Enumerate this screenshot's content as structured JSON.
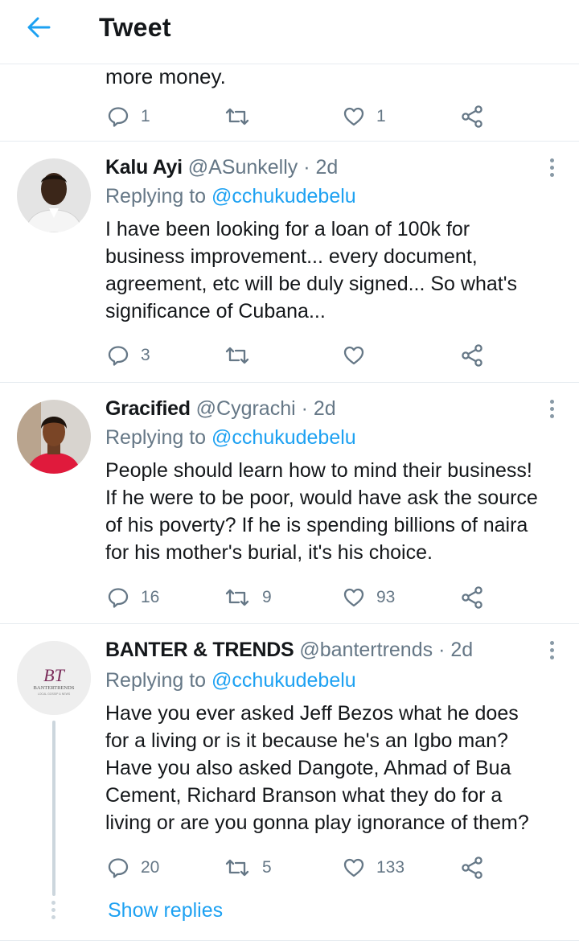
{
  "header": {
    "title": "Tweet"
  },
  "partial_tweet": {
    "text_tail": "more money.",
    "actions": {
      "replies": "1",
      "retweets": "",
      "likes": "1"
    }
  },
  "tweets": [
    {
      "display_name": "Kalu Ayi",
      "handle": "@ASunkelly",
      "time": "· 2d",
      "replying_label": "Replying to",
      "replying_handle": "@cchukudebelu",
      "lines": [
        "I have been looking for a loan of 100k for",
        "business improvement... every document,",
        "agreement, etc will be duly signed... So what's",
        "significance of Cubana..."
      ],
      "actions": {
        "replies": "3",
        "retweets": "",
        "likes": ""
      }
    },
    {
      "display_name": "Gracified",
      "handle": "@Cygrachi",
      "time": "· 2d",
      "replying_label": "Replying to",
      "replying_handle": "@cchukudebelu",
      "lines": [
        "People should learn how to mind their business!",
        "If he were to be poor, would have ask the source",
        "of his poverty? If he is spending billions of naira",
        "for his mother's burial, it's his choice."
      ],
      "actions": {
        "replies": "16",
        "retweets": "9",
        "likes": "93"
      }
    },
    {
      "display_name": "BANTER & TRENDS",
      "handle": "@bantertrends",
      "time": "· 2d",
      "replying_label": "Replying to",
      "replying_handle": "@cchukudebelu",
      "lines": [
        "Have you ever asked Jeff Bezos what he does",
        "for a living or is it because he's an Igbo man?",
        "Have you also asked Dangote, Ahmad of Bua",
        "Cement, Richard Branson what they do for a",
        "living or are you gonna play ignorance of them?"
      ],
      "actions": {
        "replies": "20",
        "retweets": "5",
        "likes": "133"
      },
      "avatar_logo": {
        "mark": "BT",
        "wordmark": "BANTERTRENDS",
        "tagline": "LOCAL GOSSIP & NEWS"
      },
      "show_replies": "Show replies"
    }
  ],
  "colors": {
    "accent": "#1da1f2",
    "secondary_text": "#657786",
    "divider": "#e6ecf0",
    "logo": "#7b2d5b"
  },
  "icons": {
    "back": "arrow-left-icon",
    "reply": "reply-bubble-icon",
    "retweet": "retweet-icon",
    "like": "heart-icon",
    "share": "share-icon",
    "more": "more-vertical-icon"
  }
}
